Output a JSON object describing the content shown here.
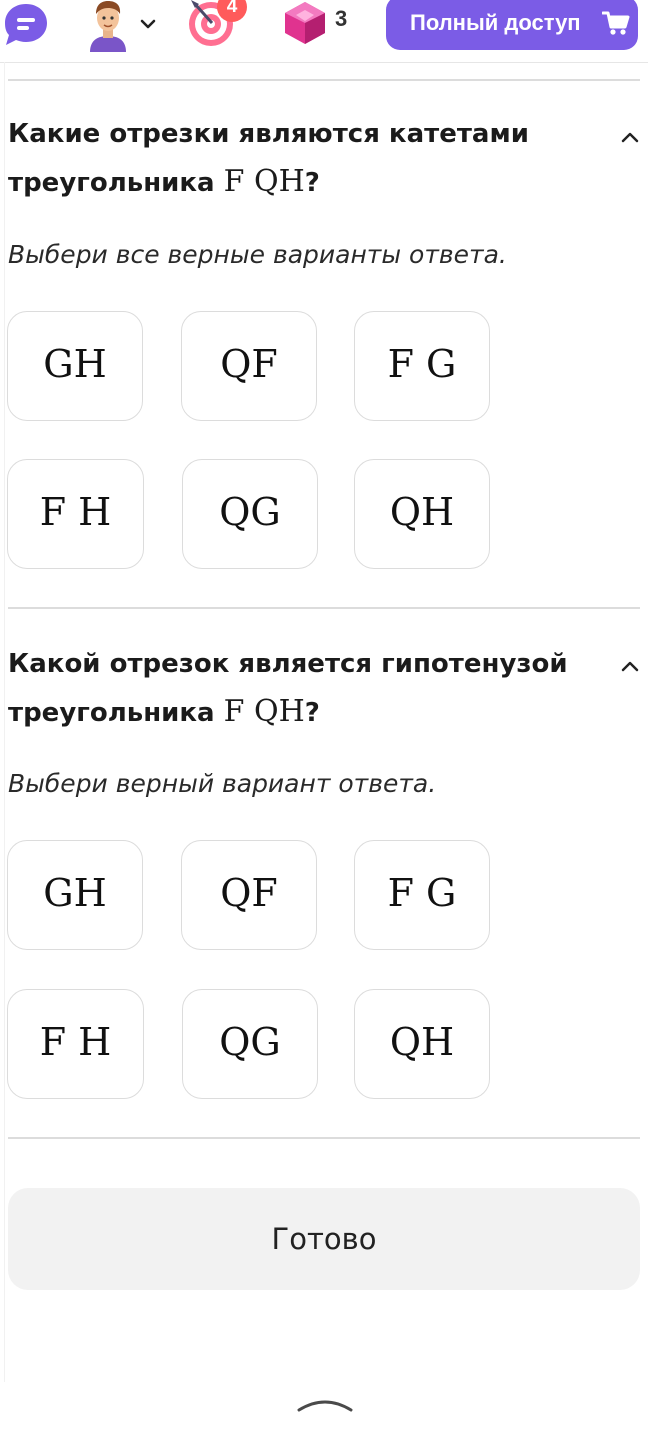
{
  "header": {
    "notifications_count": "4",
    "gems_count": "3",
    "full_access_label": "Полный доступ"
  },
  "questions": [
    {
      "title_text": "Какие отрезки являются катетами треугольника",
      "title_math": "F QH",
      "title_suffix": "?",
      "instruction": "Выбери все верные варианты ответа.",
      "options": [
        "GH",
        "QF",
        "F G",
        "F H",
        "QG",
        "QH"
      ]
    },
    {
      "title_text": "Какой отрезок является гипотенузой треугольника",
      "title_math": "F QH",
      "title_suffix": "?",
      "instruction": "Выбери верный вариант ответа.",
      "options": [
        "GH",
        "QF",
        "F G",
        "F H",
        "QG",
        "QH"
      ]
    }
  ],
  "done_label": "Готово",
  "colors": {
    "accent": "#7b5ce6",
    "notification": "#ff5b5b",
    "gem": "#e0338f",
    "option_border": "#dcdcdc",
    "done_bg": "#f2f2f2"
  }
}
